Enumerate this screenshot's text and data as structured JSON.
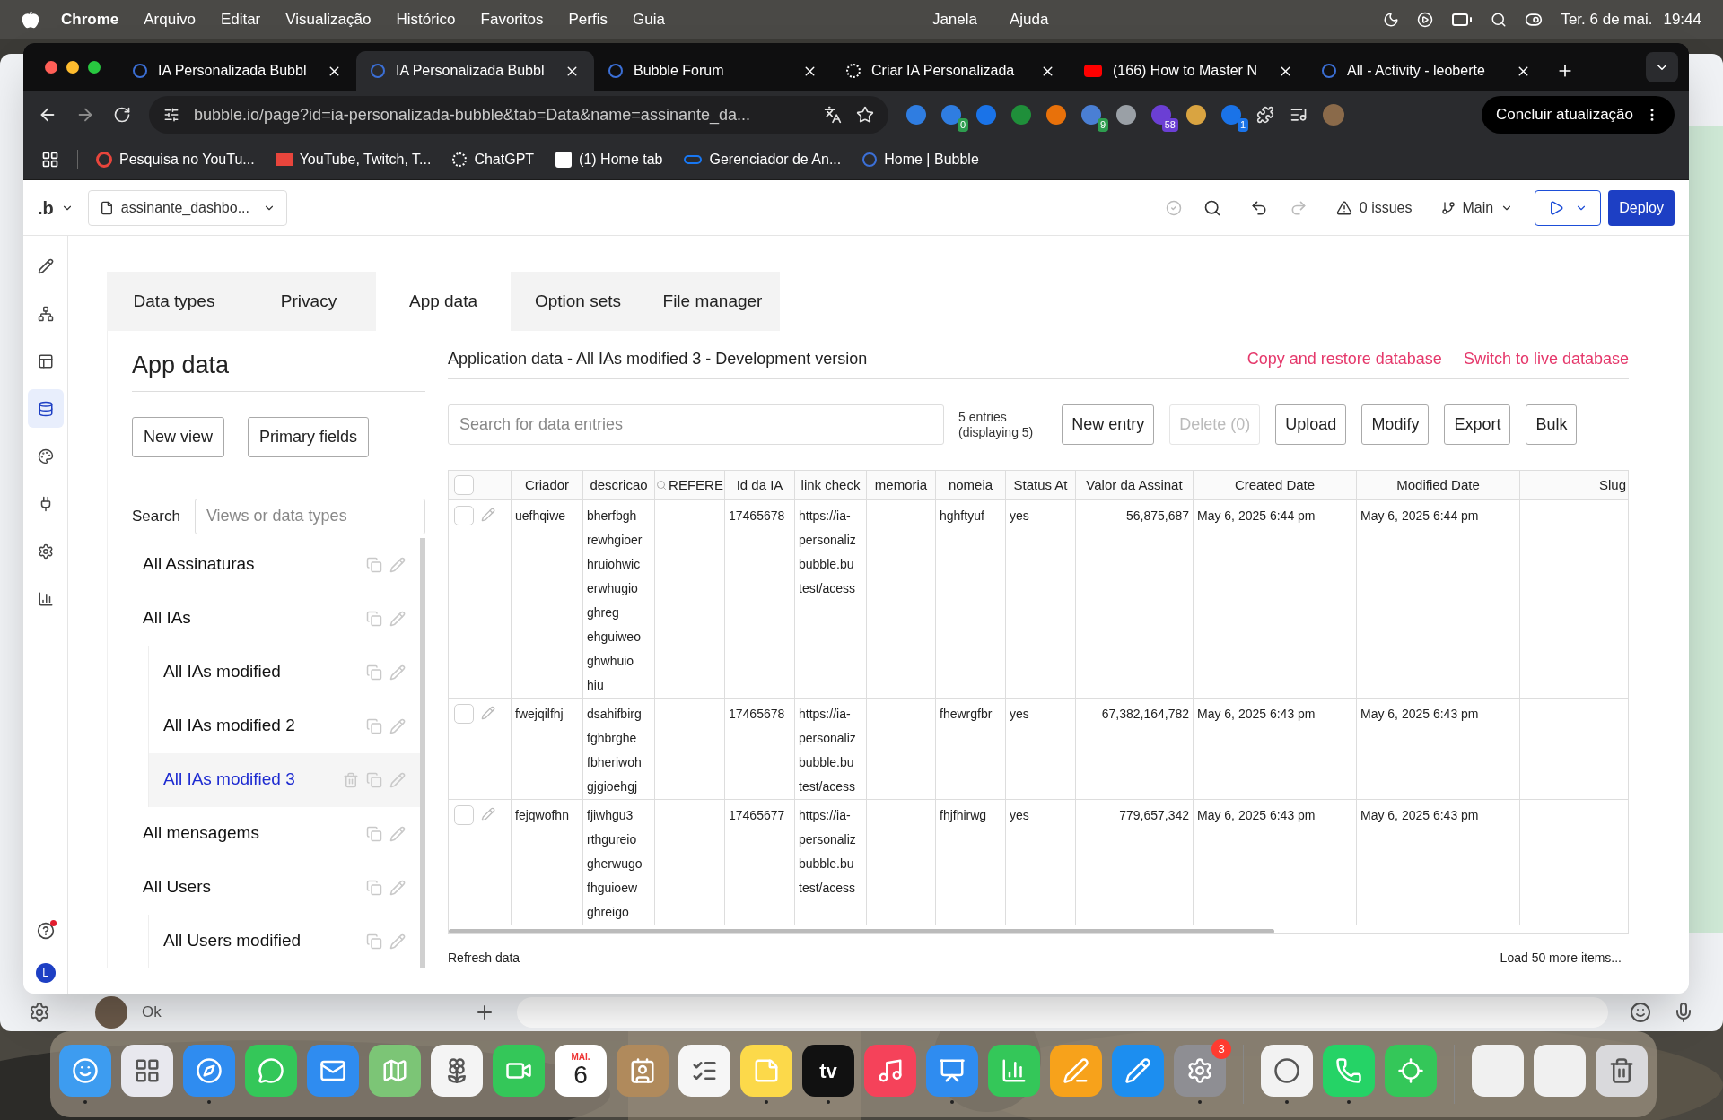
{
  "menu_bar": {
    "app": "Chrome",
    "menus": [
      "Arquivo",
      "Editar",
      "Visualização",
      "Histórico",
      "Favoritos",
      "Perfis",
      "Guia"
    ],
    "menus_right": [
      "Janela",
      "Ajuda"
    ],
    "date": "Ter. 6 de mai.",
    "time": "19:44"
  },
  "browser": {
    "tabs": [
      {
        "title": "IA Personalizada Bubbl",
        "kind": "bubble",
        "selected": false
      },
      {
        "title": "IA Personalizada Bubbl",
        "kind": "bubble",
        "selected": true
      },
      {
        "title": "Bubble Forum",
        "kind": "bubble",
        "selected": false
      },
      {
        "title": "Criar IA Personalizada",
        "kind": "spiral",
        "selected": false
      },
      {
        "title": "(166) How to Master N",
        "kind": "video",
        "selected": false
      },
      {
        "title": "All - Activity - leoberte",
        "kind": "bubble",
        "selected": false
      }
    ],
    "url": "bubble.io/page?id=ia-personalizada-bubble&tab=Data&name=assinante_da...",
    "extensions": [
      {
        "color": "#2f7de1"
      },
      {
        "color": "#2f7de1",
        "badge": {
          "text": "0",
          "color": "#2e9d4f"
        }
      },
      {
        "color": "#1a73e8"
      },
      {
        "color": "#1f8f3a"
      },
      {
        "color": "#e8710a"
      },
      {
        "color": "#4a7fd4",
        "badge": {
          "text": "9",
          "color": "#2e9d4f"
        }
      },
      {
        "color": "#9aa0a6"
      },
      {
        "color": "#6b3fd4",
        "badge": {
          "text": "58",
          "color": "#6b3fd4"
        }
      },
      {
        "color": "#d9a441"
      },
      {
        "color": "#1a73e8",
        "badge": {
          "text": "1",
          "color": "#1a73e8"
        }
      }
    ],
    "update_button": "Concluir atualização",
    "bookmarks": [
      {
        "label": "Pesquisa no YouTu...",
        "kind": "red"
      },
      {
        "label": "YouTube, Twitch, T...",
        "kind": "bars"
      },
      {
        "label": "ChatGPT",
        "kind": "spiral"
      },
      {
        "label": "(1) Home tab",
        "kind": "square"
      },
      {
        "label": "Gerenciador de An...",
        "kind": "infinity"
      },
      {
        "label": "Home | Bubble",
        "kind": "bubble"
      }
    ]
  },
  "editor": {
    "logo": ".b",
    "page": "assinante_dashbo...",
    "issues": "0 issues",
    "branch": "Main",
    "deploy": "Deploy",
    "rail": [
      {
        "kind": "design",
        "selected": false
      },
      {
        "kind": "workflow",
        "selected": false
      },
      {
        "kind": "layout",
        "selected": false
      },
      {
        "kind": "data",
        "selected": true
      },
      {
        "kind": "styles",
        "selected": false
      },
      {
        "kind": "plugins",
        "selected": false
      },
      {
        "kind": "settings",
        "selected": false
      },
      {
        "kind": "logs",
        "selected": false
      }
    ],
    "help_notification": true,
    "avatar": "L",
    "tabs": [
      {
        "label": "Data types",
        "selected": false
      },
      {
        "label": "Privacy",
        "selected": false
      },
      {
        "label": "App data",
        "selected": true
      },
      {
        "label": "Option sets",
        "selected": false
      },
      {
        "label": "File manager",
        "selected": false
      }
    ],
    "panel": {
      "title": "App data",
      "buttons": [
        "New view",
        "Primary fields"
      ],
      "search_label": "Search",
      "search_placeholder": "Views or data types",
      "views": [
        {
          "label": "All Assinaturas",
          "selected": false
        },
        {
          "label": "All IAs",
          "selected": false,
          "children": [
            {
              "label": "All IAs modified",
              "selected": false
            },
            {
              "label": "All IAs modified 2",
              "selected": false
            },
            {
              "label": "All IAs modified 3",
              "selected": true
            }
          ]
        },
        {
          "label": "All mensagems",
          "selected": false
        },
        {
          "label": "All Users",
          "selected": false,
          "children": [
            {
              "label": "All Users modified",
              "selected": false
            }
          ]
        }
      ]
    },
    "main": {
      "heading": "Application data - All IAs modified 3 - Development version",
      "links": [
        "Copy and restore database",
        "Switch to live database"
      ],
      "search_placeholder": "Search for data entries",
      "entry_count": "5 entries",
      "displaying": "(displaying 5)",
      "actions": [
        {
          "label": "New entry",
          "disabled": false
        },
        {
          "label": "Delete (0)",
          "disabled": true
        },
        {
          "label": "Upload",
          "disabled": false
        },
        {
          "label": "Modify",
          "disabled": false
        },
        {
          "label": "Export",
          "disabled": false
        },
        {
          "label": "Bulk",
          "disabled": false
        }
      ],
      "table": {
        "header_checked": false,
        "columns": [
          {
            "label": "Criador",
            "kind": "text"
          },
          {
            "label": "descricao",
            "kind": "text"
          },
          {
            "label": "REFERE",
            "kind": "search"
          },
          {
            "label": "Id da IA",
            "kind": "text"
          },
          {
            "label": "link check",
            "kind": "text"
          },
          {
            "label": "memoria",
            "kind": "text"
          },
          {
            "label": "nomeia",
            "kind": "text"
          },
          {
            "label": "Status At",
            "kind": "text"
          },
          {
            "label": "Valor da Assinat",
            "kind": "number"
          },
          {
            "label": "Created Date",
            "kind": "date"
          },
          {
            "label": "Modified Date",
            "kind": "date"
          },
          {
            "label": "Slug",
            "kind": "number"
          }
        ],
        "rows": [
          {
            "checked": false,
            "criador": "uefhqiwe",
            "descricao": [
              "bherfbgh",
              "rewhgioer",
              "hruiohwic",
              "erwhugio",
              "ghreg",
              "ehguiweo",
              "ghwhuio",
              "hiu"
            ],
            "id_da_ia": "17465678",
            "link_check": [
              "https://ia-",
              "personaliz",
              "bubble.bu",
              "test/acess"
            ],
            "nomeia": "hghftyuf",
            "status": "yes",
            "valor": "56,875,687",
            "created_date": "May 6, 2025 6:44 pm",
            "modified_date": "May 6, 2025 6:44 pm"
          },
          {
            "checked": false,
            "criador": "fwejqilfhj",
            "descricao": [
              "dsahifbirg",
              "fghbrghe",
              "fbheriwoh",
              "gjgioehgj"
            ],
            "id_da_ia": "17465678",
            "link_check": [
              "https://ia-",
              "personaliz",
              "bubble.bu",
              "test/acess"
            ],
            "nomeia": "fhewrgfbr",
            "status": "yes",
            "valor": "67,382,164,782",
            "created_date": "May 6, 2025 6:43 pm",
            "modified_date": "May 6, 2025 6:43 pm"
          },
          {
            "checked": false,
            "criador": "fejqwofhn",
            "descricao": [
              "fjiwhgu3",
              "rthgureio",
              "gherwugo",
              "fhguioew",
              "ghreigo"
            ],
            "id_da_ia": "17465677",
            "link_check": [
              "https://ia-",
              "personaliz",
              "bubble.bu",
              "test/acess"
            ],
            "nomeia": "fhjfhirwg",
            "status": "yes",
            "valor": "779,657,342",
            "created_date": "May 6, 2025 6:43 pm",
            "modified_date": "May 6, 2025 6:43 pm"
          }
        ]
      },
      "refresh": "Refresh data",
      "load_more": "Load 50 more items..."
    }
  },
  "background_window": {
    "last_message": "Ok"
  },
  "dock": [
    {
      "kind": "finder",
      "running": true
    },
    {
      "kind": "launchpad",
      "running": false
    },
    {
      "kind": "safari",
      "running": true
    },
    {
      "kind": "messages",
      "running": false
    },
    {
      "kind": "mail",
      "running": false
    },
    {
      "kind": "maps",
      "running": false
    },
    {
      "kind": "photos",
      "running": false
    },
    {
      "kind": "facetime",
      "running": false
    },
    {
      "kind": "calendar",
      "month": "MAI.",
      "day": "6",
      "running": false
    },
    {
      "kind": "contacts",
      "running": false
    },
    {
      "kind": "reminders",
      "running": false
    },
    {
      "kind": "notes",
      "running": true
    },
    {
      "kind": "tv",
      "text": "tv",
      "running": true
    },
    {
      "kind": "music",
      "running": false
    },
    {
      "kind": "keynote",
      "running": true
    },
    {
      "kind": "numbers",
      "running": false
    },
    {
      "kind": "pages",
      "running": false
    },
    {
      "kind": "appstore",
      "running": false
    },
    {
      "kind": "settings",
      "badge": "3",
      "running": true
    },
    {
      "kind": "separator"
    },
    {
      "kind": "chrome",
      "running": true
    },
    {
      "kind": "whatsapp",
      "running": true
    },
    {
      "kind": "findmy",
      "running": false
    },
    {
      "kind": "separator"
    },
    {
      "kind": "window",
      "running": false
    },
    {
      "kind": "window",
      "running": false
    },
    {
      "kind": "trash",
      "running": false
    }
  ]
}
